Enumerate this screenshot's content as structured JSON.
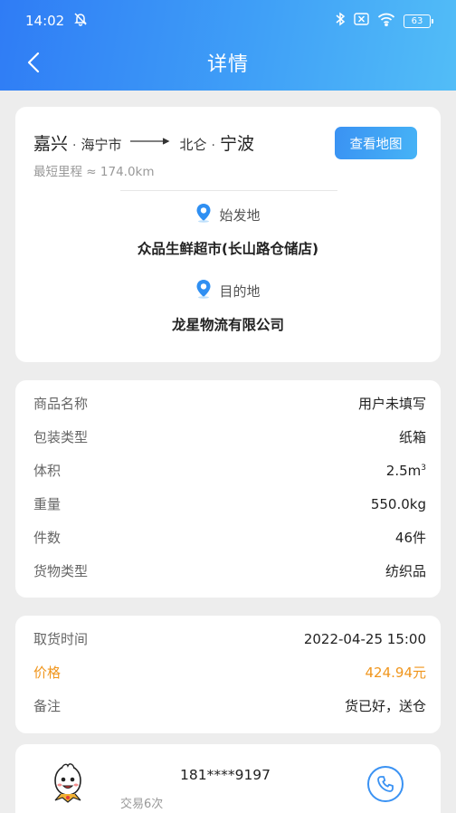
{
  "status_bar": {
    "time": "14:02",
    "battery": "63",
    "icons": [
      "alarm-off-icon",
      "bluetooth-icon",
      "sim-x-icon",
      "wifi-icon",
      "battery-icon"
    ]
  },
  "nav": {
    "title": "详情",
    "back_icon": "chevron-left-icon"
  },
  "route": {
    "from_city": "嘉兴",
    "from_district": "海宁市",
    "to_district": "北仑",
    "to_city": "宁波",
    "distance": "最短里程 ≈ 174.0km",
    "map_button": "查看地图",
    "origin_label": "始发地",
    "origin_name": "众品生鲜超市(长山路仓储店)",
    "dest_label": "目的地",
    "dest_name": "龙星物流有限公司"
  },
  "goods": {
    "name_label": "商品名称",
    "name_value": "用户未填写",
    "package_label": "包装类型",
    "package_value": "纸箱",
    "volume_label": "体积",
    "volume_value": "2.5m",
    "volume_unit_sup": "3",
    "weight_label": "重量",
    "weight_value": "550.0kg",
    "count_label": "件数",
    "count_value": "46件",
    "type_label": "货物类型",
    "type_value": "纺织品"
  },
  "order": {
    "pickup_label": "取货时间",
    "pickup_value": "2022-04-25 15:00",
    "price_label": "价格",
    "price_value": "424.94元",
    "note_label": "备注",
    "note_value": "货已好，送仓"
  },
  "contact": {
    "phone": "181****9197",
    "trades": "交易6次"
  },
  "colors": {
    "header_start": "#2f7cf5",
    "header_end": "#52bdf7",
    "accent_blue": "#3a92f3",
    "price_orange": "#f0961d",
    "page_bg": "#ededed"
  }
}
